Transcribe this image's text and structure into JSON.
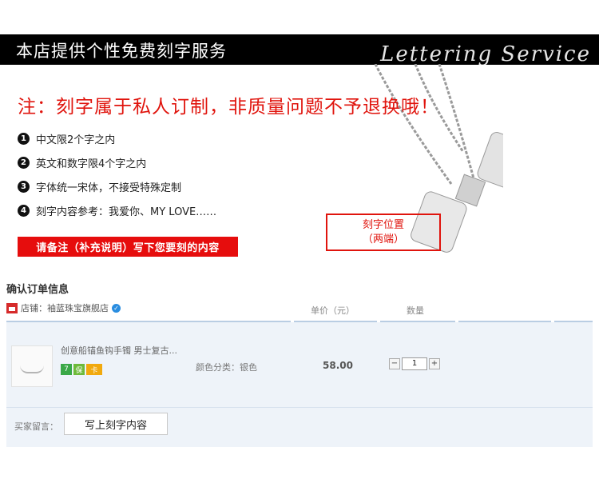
{
  "banner": {
    "title": "本店提供个性免费刻字服务",
    "script_text": "Lettering Service"
  },
  "notice": "注：刻字属于私人订制，非质量问题不予退换哦！",
  "rules": [
    {
      "num": "1",
      "text": "中文限2个字之内"
    },
    {
      "num": "2",
      "text": "英文和数字限4个字之内"
    },
    {
      "num": "3",
      "text": "字体统一宋体，不接受特殊定制"
    },
    {
      "num": "4",
      "text": "刻字内容参考：我爱你、MY LOVE……"
    }
  ],
  "red_button_label": "请备注（补充说明）写下您要刻的内容",
  "engrave_position": {
    "line1": "刻字位置",
    "line2": "（两端）"
  },
  "order": {
    "title": "确认订单信息",
    "shop_label": "店铺：",
    "shop_name": "袖蓝珠宝旗舰店",
    "columns": {
      "unit_price": "单价（元）",
      "quantity": "数量"
    },
    "item": {
      "title": "创意船锚鱼钩手镯 男士复古...",
      "badges": [
        "7",
        "保",
        "卡"
      ],
      "variant": "颜色分类：银色",
      "price": "58.00",
      "quantity": "1"
    },
    "buyer_message_label": "买家留言：",
    "buyer_message_value": "写上刻字内容"
  },
  "colors": {
    "accent_red": "#e0140d",
    "banner_bg": "#000000",
    "panel_bg": "#eef3f9"
  }
}
